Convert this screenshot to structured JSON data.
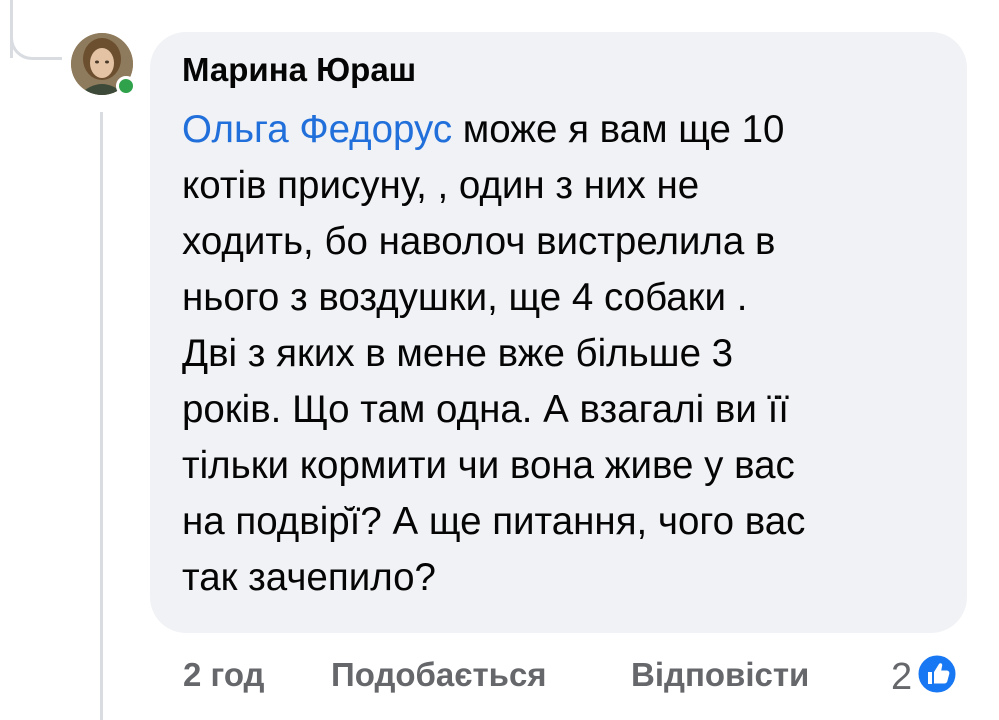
{
  "comment": {
    "author": "Марина Юраш",
    "mention": "Ольга Федорус",
    "lines": [
      " може я вам ще 10",
      "котів присуну, , один з них не",
      "ходить, бо наволоч вистрелила в",
      "нього з воздушки, ще 4 собаки .",
      "Дві з яких в мене вже більше 3",
      "років.  Що там одна. А взагалі ви її",
      "тільки кормити чи вона живе у вас",
      "на подвір̆ї? А ще питання, чого вас",
      "так зачепило?"
    ]
  },
  "actions": {
    "time": "2 год",
    "like_label": "Подобається",
    "reply_label": "Відповісти",
    "reaction_count": "2",
    "reaction_icon": "thumbs-up-icon"
  },
  "colors": {
    "bubble_bg": "#f0f2f5",
    "mention": "#216fdb",
    "action_text": "#65676b",
    "online": "#31a24c",
    "like_blue": "#1877f2"
  }
}
